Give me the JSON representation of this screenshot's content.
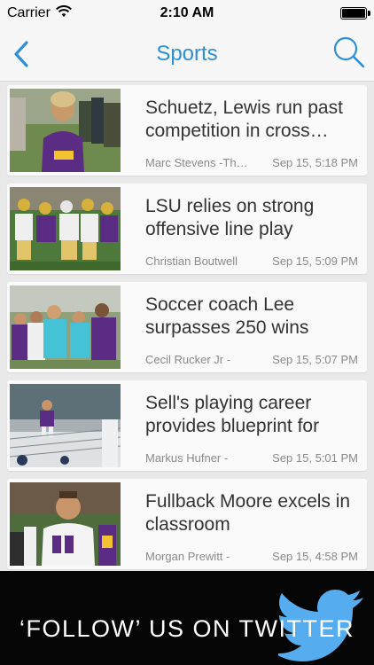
{
  "status_bar": {
    "carrier": "Carrier",
    "time": "2:10 AM",
    "battery_level": 1.0
  },
  "nav": {
    "title": "Sports",
    "back_icon": "chevron-left-icon",
    "search_icon": "search-icon",
    "accent_color": "#2f8fd5"
  },
  "articles": [
    {
      "headline": "Schuetz, Lewis run past competition in cross country",
      "byline": "Marc Stevens -The Daily Reveille",
      "date": "Sep 15, 5:18 PM"
    },
    {
      "headline": "LSU relies on strong offensive line play",
      "byline": "Christian Boutwell",
      "date": "Sep 15, 5:09 PM"
    },
    {
      "headline": "Soccer coach Lee surpasses 250 wins",
      "byline": "Cecil Rucker Jr -",
      "date": "Sep 15, 5:07 PM"
    },
    {
      "headline": "Sell's playing career provides blueprint for",
      "byline": "Markus Hufner -",
      "date": "Sep 15, 5:01 PM"
    },
    {
      "headline": "Fullback Moore excels in classroom",
      "byline": "Morgan Prewitt -",
      "date": "Sep 15, 4:58 PM"
    }
  ],
  "ad": {
    "text": "‘FOLLOW’ US ON TWITTER",
    "icon": "twitter-bird-icon",
    "brand_color": "#55acee"
  }
}
